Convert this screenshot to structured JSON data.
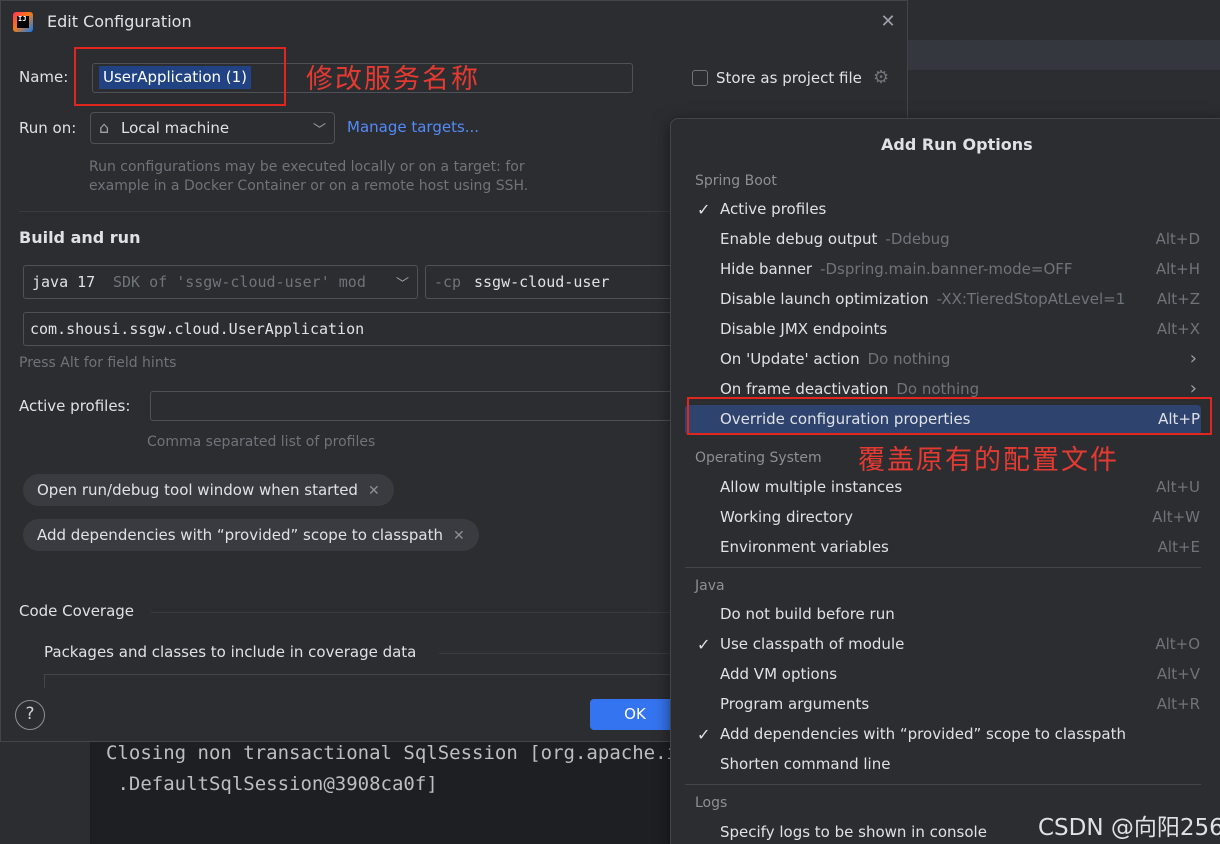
{
  "dialog": {
    "title": "Edit Configuration",
    "name_label": "Name:",
    "name_value": "UserApplication (1)",
    "name_annotation": "修改服务名称",
    "store_label": "Store as project file",
    "run_on_label": "Run on:",
    "run_on_value": "Local machine",
    "manage_targets": "Manage targets...",
    "run_on_hint_1": "Run configurations may be executed locally or on a target: for",
    "run_on_hint_2": "example in a Docker Container or on a remote host using SSH.",
    "build_and_run": "Build and run",
    "sdk_main": "java 17",
    "sdk_sub": "SDK of 'ssgw-cloud-user' mod",
    "cp_flag": "-cp",
    "cp_value": "ssgw-cloud-user",
    "main_class": "com.shousi.ssgw.cloud.UserApplication",
    "field_hints": "Press Alt for field hints",
    "active_profiles_label": "Active profiles:",
    "active_profiles_value": "",
    "profiles_hint": "Comma separated list of profiles",
    "chip_1": "Open run/debug tool window when started",
    "chip_2": "Add dependencies with “provided” scope to classpath",
    "code_coverage": "Code Coverage",
    "coverage_packages": "Packages and classes to include in coverage data",
    "ok": "OK",
    "help": "?"
  },
  "console": {
    "line_1": "Closing non transactional SqlSession [org.apache.iba",
    "line_2": " .DefaultSqlSession@3908ca0f]"
  },
  "popup": {
    "title": "Add Run Options",
    "annotation": "覆盖原有的配置文件",
    "groups": {
      "spring_boot": "Spring Boot",
      "operating_system": "Operating System",
      "java": "Java",
      "logs": "Logs"
    },
    "items": [
      {
        "name": "Active profiles",
        "sub": "",
        "key": "",
        "checked": "✓"
      },
      {
        "name": "Enable debug output",
        "sub": "-Ddebug",
        "key": "Alt+D",
        "checked": ""
      },
      {
        "name": "Hide banner",
        "sub": "-Dspring.main.banner-mode=OFF",
        "key": "Alt+H",
        "checked": ""
      },
      {
        "name": "Disable launch optimization",
        "sub": "-XX:TieredStopAtLevel=1",
        "key": "Alt+Z",
        "checked": ""
      },
      {
        "name": "Disable JMX endpoints",
        "sub": "",
        "key": "Alt+X",
        "checked": ""
      },
      {
        "name": "On 'Update' action",
        "sub": "Do nothing",
        "key": "",
        "checked": ""
      },
      {
        "name": "On frame deactivation",
        "sub": "Do nothing",
        "key": "",
        "checked": ""
      },
      {
        "name": "Override configuration properties",
        "sub": "",
        "key": "Alt+P",
        "checked": ""
      },
      {
        "name": "Allow multiple instances",
        "sub": "",
        "key": "Alt+U",
        "checked": ""
      },
      {
        "name": "Working directory",
        "sub": "",
        "key": "Alt+W",
        "checked": ""
      },
      {
        "name": "Environment variables",
        "sub": "",
        "key": "Alt+E",
        "checked": ""
      },
      {
        "name": "Do not build before run",
        "sub": "",
        "key": "",
        "checked": ""
      },
      {
        "name": "Use classpath of module",
        "sub": "",
        "key": "Alt+O",
        "checked": "✓"
      },
      {
        "name": "Add VM options",
        "sub": "",
        "key": "Alt+V",
        "checked": ""
      },
      {
        "name": "Program arguments",
        "sub": "",
        "key": "Alt+R",
        "checked": ""
      },
      {
        "name": "Add dependencies with “provided” scope to classpath",
        "sub": "",
        "key": "",
        "checked": "✓"
      },
      {
        "name": "Shorten command line",
        "sub": "",
        "key": "",
        "checked": ""
      },
      {
        "name": "Specify logs to be shown in console",
        "sub": "",
        "key": "",
        "checked": ""
      }
    ]
  },
  "watermark": "CSDN @向阳256"
}
